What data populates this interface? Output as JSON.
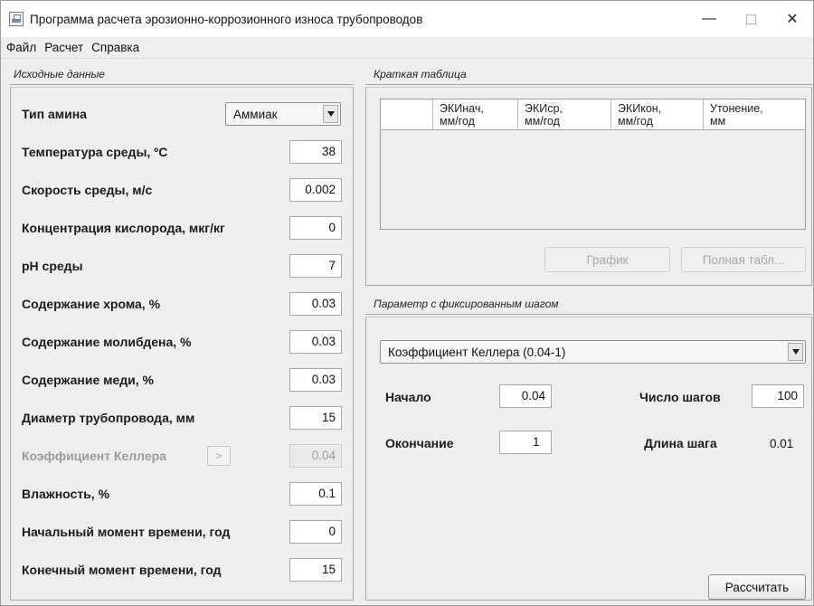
{
  "window": {
    "title": "Программа расчета эрозионно-коррозионного износа трубопроводов",
    "minimize_glyph": "—",
    "close_glyph": "✕"
  },
  "menu": [
    "Файл",
    "Расчет",
    "Справка"
  ],
  "input_panel": {
    "caption": "Исходные данные",
    "amine_type": {
      "label": "Тип амина",
      "value": "Аммиак"
    },
    "fields": [
      {
        "label": "Температура среды, ºC",
        "value": "38"
      },
      {
        "label": "Скорость среды, м/с",
        "value": "0.002"
      },
      {
        "label": "Концентрация кислорода, мкг/кг",
        "value": "0"
      },
      {
        "label": "pH среды",
        "value": "7"
      },
      {
        "label": "Содержание хрома, %",
        "value": "0.03"
      },
      {
        "label": "Содержание молибдена, %",
        "value": "0.03"
      },
      {
        "label": "Содержание меди, %",
        "value": "0.03"
      },
      {
        "label": "Диаметр трубопровода, мм",
        "value": "15"
      },
      {
        "label": "Коэффициент Келлера",
        "value": "0.04",
        "button": ">",
        "disabled": true
      },
      {
        "label": "Влажность, %",
        "value": "0.1"
      },
      {
        "label": "Начальный момент времени, год",
        "value": "0"
      },
      {
        "label": "Конечный момент времени, год",
        "value": "15"
      }
    ]
  },
  "summary_panel": {
    "caption": "Краткая таблица",
    "columns": [
      {
        "line1": "ЭКИнач,",
        "line2": "мм/год"
      },
      {
        "line1": "ЭКИср,",
        "line2": "мм/год"
      },
      {
        "line1": "ЭКИкон,",
        "line2": "мм/год"
      },
      {
        "line1": "Утонение,",
        "line2": "мм"
      }
    ],
    "chart_button": "График",
    "full_table_button": "Полная табл..."
  },
  "param_panel": {
    "caption": "Параметр с фиксированным шагом",
    "parameter": "Коэффициент Келлера (0.04-1)",
    "start_label": "Начало",
    "start_value": "0.04",
    "end_label": "Окончание",
    "end_value": "1",
    "steps_label": "Число шагов",
    "steps_value": "100",
    "step_length_label": "Длина шага",
    "step_length_value": "0.01",
    "calculate_button": "Рассчитать"
  }
}
